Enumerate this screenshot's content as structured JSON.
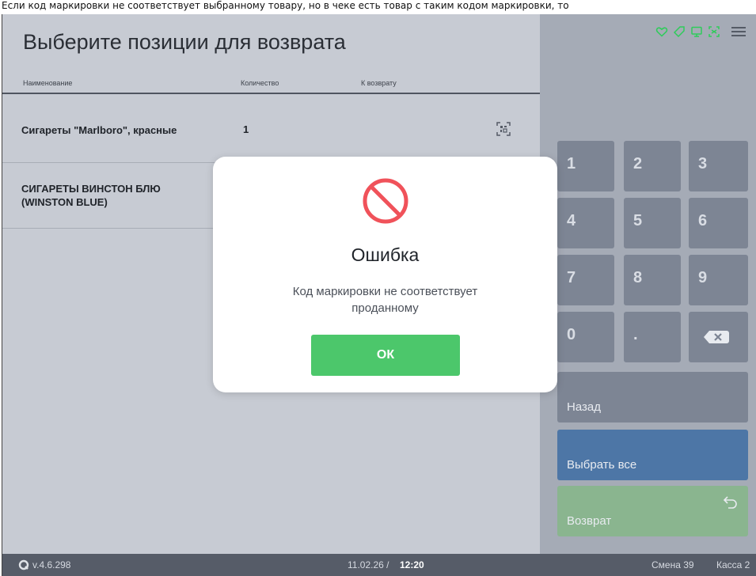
{
  "caption": "Если код маркировки не соответствует выбранному товару, но в чеке есть товар с таким кодом маркировки, то",
  "screen": {
    "title": "Выберите позиции для возврата",
    "columns": [
      "Наименование",
      "Количество",
      "К возврату"
    ],
    "rows": [
      {
        "name": "Сигареты \"Marlboro\", красные",
        "qty": "1",
        "icon": "datamatrix-icon"
      },
      {
        "name_line1": "СИГАРЕТЫ ВИНСТОН БЛЮ",
        "name_line2": "(WINSTON BLUE)",
        "qty": ""
      }
    ]
  },
  "top_icons": [
    "heart-icon",
    "tag-icon",
    "monitor-icon",
    "scan-icon",
    "menu-icon"
  ],
  "keypad": {
    "keys": [
      "1",
      "2",
      "3",
      "4",
      "5",
      "6",
      "7",
      "8",
      "9",
      "0",
      ".",
      "⌫"
    ],
    "back_label": "Назад",
    "select_all_label": "Выбрать все",
    "return_label": "Возврат"
  },
  "modal": {
    "title": "Ошибка",
    "message": "Код маркировки не соответствует проданному",
    "ok_label": "ОК",
    "icon": "forbidden-icon"
  },
  "status": {
    "version": "v.4.6.298",
    "date": "11.02.26 /",
    "time": "12:20",
    "shift": "Смена 39",
    "register": "Касса 2"
  },
  "colors": {
    "left_bg": "#c7cbd3",
    "right_bg": "#a5abb6",
    "key_bg": "#7d8594",
    "select_all_bg": "#4d76a6",
    "return_bg": "#8ab58f",
    "ok_bg": "#4cc76b",
    "error_red": "#f0525a",
    "accent_green": "#2ecc5a"
  }
}
